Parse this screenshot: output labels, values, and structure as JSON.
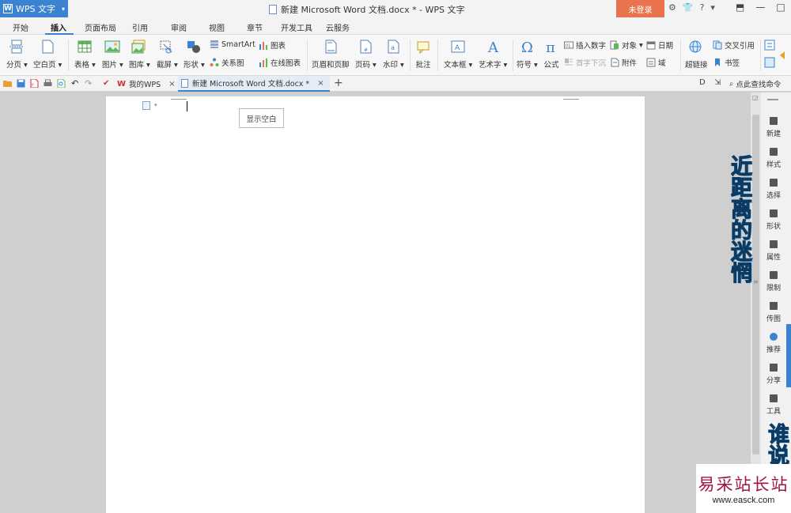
{
  "titlebar": {
    "app_name": "WPS 文字",
    "app_logo": "W",
    "doc_title": "新建 Microsoft Word 文档.docx * - WPS 文字",
    "login_label": "未登录",
    "icons": [
      "settings-icon",
      "skin-icon",
      "help-icon"
    ],
    "help_label": "?",
    "minimize": "—",
    "maximize": "□",
    "close": "✕"
  },
  "menu_tabs": [
    "开始",
    "插入",
    "页面布局",
    "引用",
    "审阅",
    "视图",
    "章节",
    "开发工具",
    "云服务"
  ],
  "active_tab": "插入",
  "ribbon": {
    "fenye": "分页",
    "kongbaiye": "空白页",
    "biaoge": "表格",
    "tupian": "图片",
    "tuku": "图库",
    "jieping": "截屏",
    "xingzhuang": "形状",
    "smartart": "SmartArt",
    "tubiao": "图表",
    "guanxitu": "关系图",
    "zaixian_tubiao": "在线图表",
    "yemei_yejiao": "页眉和页脚",
    "yema": "页码",
    "shuiyin": "水印",
    "pizhu": "批注",
    "wenbenkuang": "文本框",
    "yishuzi": "艺术字",
    "fuhao": "符号",
    "gongshi": "公式",
    "charu_shuzi": "插入数字",
    "duixiang": "对象",
    "riqi": "日期",
    "shouzi_xiachen": "首字下沉",
    "fujian": "附件",
    "yu": "域",
    "chaolianjie": "超链接",
    "jiaocha_yinyong": "交叉引用",
    "shuqian": "书签"
  },
  "doc_tabs": {
    "my_wps": "我的WPS",
    "current_doc": "新建 Microsoft Word 文档.docx *",
    "close": "×",
    "new_tab": "+",
    "search_command": "点此查找命令"
  },
  "document": {
    "show_blank_label": "显示空白"
  },
  "right_panel": {
    "items": [
      "新建",
      "样式",
      "选择",
      "形状",
      "属性",
      "限制",
      "传图",
      "推荐",
      "分享",
      "工具"
    ]
  },
  "overlay": {
    "vertical_text_1": "近距离的迷惘",
    "vertical_text_2": "谁说",
    "site_name": "易采站长站",
    "site_url": "www.easck.com"
  },
  "colors": {
    "accent": "#3b83d1",
    "login": "#e8734e"
  }
}
